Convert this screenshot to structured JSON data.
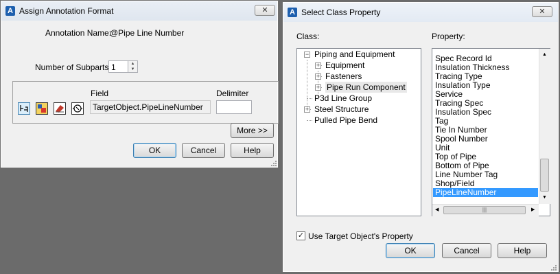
{
  "assign_dialog": {
    "title": "Assign Annotation Format",
    "annotation_name_label": "Annotation Name:",
    "annotation_name_value": "@Pipe Line Number",
    "subparts_label": "Number of Subparts:",
    "subparts_value": "1",
    "field_header": "Field",
    "delimiter_header": "Delimiter",
    "field_value": "TargetObject.PipeLineNumber",
    "delimiter_value": "",
    "more_button": "More >>",
    "ok_button": "OK",
    "cancel_button": "Cancel",
    "help_button": "Help",
    "close_glyph": "✕"
  },
  "select_dialog": {
    "title": "Select Class Property",
    "class_label": "Class:",
    "property_label": "Property:",
    "tree": {
      "piping": "Piping and Equipment",
      "equipment": "Equipment",
      "fasteners": "Fasteners",
      "pipe_run": "Pipe Run Component",
      "p3d_line": "P3d Line Group",
      "steel": "Steel Structure",
      "pulled": "Pulled Pipe Bend"
    },
    "properties": [
      "Spec Record Id",
      "Insulation Thickness",
      "Tracing Type",
      "Insulation Type",
      "Service",
      "Tracing Spec",
      "Insulation Spec",
      "Tag",
      "Tie In Number",
      "Spool Number",
      "Unit",
      "Top of Pipe",
      "Bottom of Pipe",
      "Line Number Tag",
      "Shop/Field",
      "PipeLineNumber"
    ],
    "selected_property": "PipeLineNumber",
    "use_target_label": "Use Target Object's Property",
    "use_target_checked": true,
    "ok_button": "OK",
    "cancel_button": "Cancel",
    "help_button": "Help",
    "close_glyph": "✕"
  },
  "app_icon_letter": "A",
  "accent_color": "#3399ff"
}
